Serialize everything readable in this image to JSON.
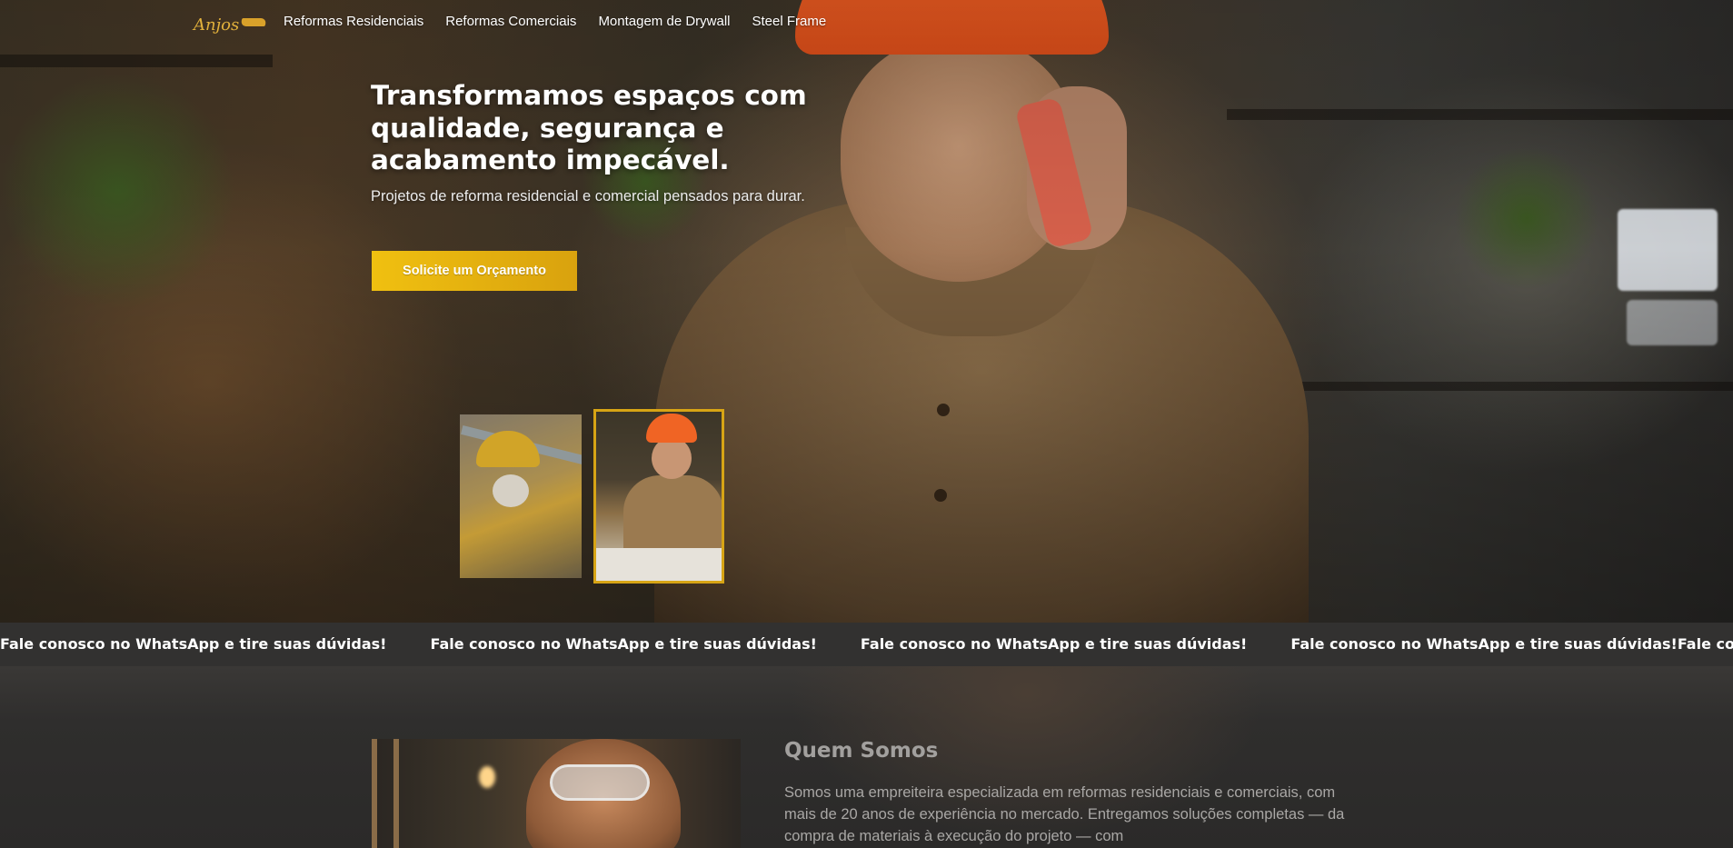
{
  "brand": {
    "logo_text": "Anjos"
  },
  "nav": {
    "links": [
      {
        "label": "Reformas Residenciais"
      },
      {
        "label": "Reformas Comerciais"
      },
      {
        "label": "Montagem de Drywall"
      },
      {
        "label": "Steel Frame"
      }
    ]
  },
  "hero": {
    "title": "Transformamos espaços com qualidade, segurança e acabamento impecável.",
    "subtitle": "Projetos de reforma residencial e comercial pensados para durar.",
    "cta_label": "Solicite um Orçamento"
  },
  "marquee": {
    "text": "Fale conosco no WhatsApp e tire suas dúvidas!"
  },
  "about": {
    "title": "Quem Somos",
    "text": "Somos uma empreiteira especializada em reformas residenciais e comerciais, com mais de 20 anos de experiência no mercado. Entregamos soluções completas — da compra de materiais à execução do projeto — com"
  },
  "colors": {
    "accent": "#f0c010",
    "accent_dark": "#d9a20e",
    "marquee_bg": "#323130",
    "page_bg": "#2d2c2b"
  },
  "icons": {
    "logo_mark": "golden-wing-icon"
  }
}
